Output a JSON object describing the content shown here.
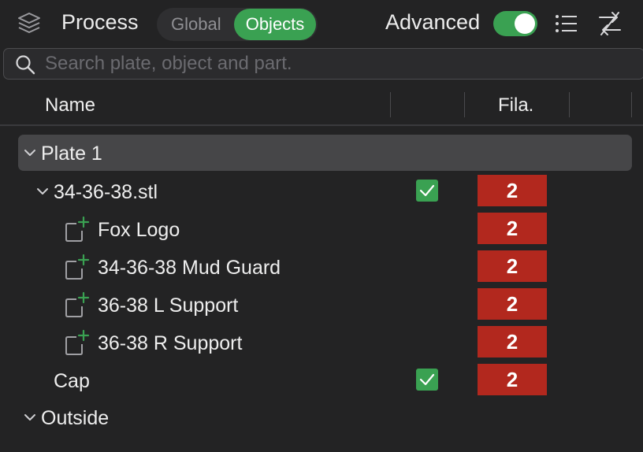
{
  "header": {
    "title": "Process",
    "segment": {
      "global_label": "Global",
      "objects_label": "Objects",
      "selected": "Objects"
    },
    "advanced_label": "Advanced",
    "advanced_on": true,
    "icons": [
      "stack-icon",
      "list-icon",
      "compare-icon"
    ]
  },
  "search": {
    "placeholder": "Search plate, object and part.",
    "value": ""
  },
  "columns": {
    "name": "Name",
    "fila": "Fila."
  },
  "tree": {
    "plate": {
      "label": "Plate 1"
    },
    "object1": {
      "label": "34-36-38.stl",
      "checked": true,
      "fila": "2"
    },
    "parts": [
      {
        "label": "Fox Logo",
        "fila": "2"
      },
      {
        "label": "34-36-38 Mud Guard",
        "fila": "2"
      },
      {
        "label": "36-38 L Support",
        "fila": "2"
      },
      {
        "label": "36-38 R Support",
        "fila": "2"
      }
    ],
    "object2": {
      "label": "Cap",
      "checked": true,
      "fila": "2"
    },
    "outside": {
      "label": "Outside"
    }
  },
  "colors": {
    "accent": "#3aa152",
    "filament": "#b2281e",
    "background": "#232324",
    "row_highlight": "#464648"
  }
}
